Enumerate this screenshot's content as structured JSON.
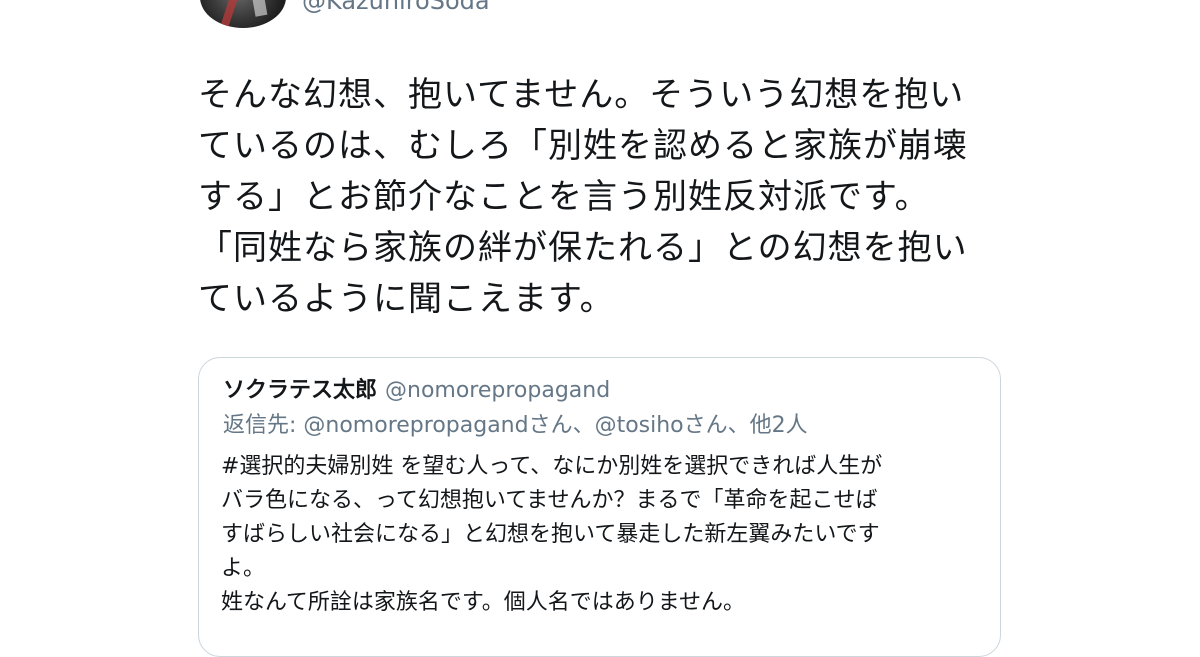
{
  "author": {
    "handle": "@KazuhiroSoda"
  },
  "tweet": {
    "lines": [
      "そんな幻想、抱いてません。そういう幻想を抱い",
      "ているのは、むしろ「別姓を認めると家族が崩壊",
      "する」とお節介なことを言う別姓反対派です。",
      "「同姓なら家族の絆が保たれる」との幻想を抱い",
      "ているように聞こえます。"
    ]
  },
  "quoted_tweet": {
    "name": "ソクラテス太郎",
    "handle": "@nomorepropagand",
    "reply_to": "返信先: @nomorepropagandさん、@tosihoさん、他2人",
    "lines": [
      "#選択的夫婦別姓 を望む人って、なにか別姓を選択できれば人生が",
      "バラ色になる、って幻想抱いてませんか？まるで「革命を起こせば",
      "すばらしい社会になる」と幻想を抱いて暴走した新左翼みたいです",
      "よ。",
      "姓なんて所詮は家族名です。個人名ではありません。"
    ]
  }
}
